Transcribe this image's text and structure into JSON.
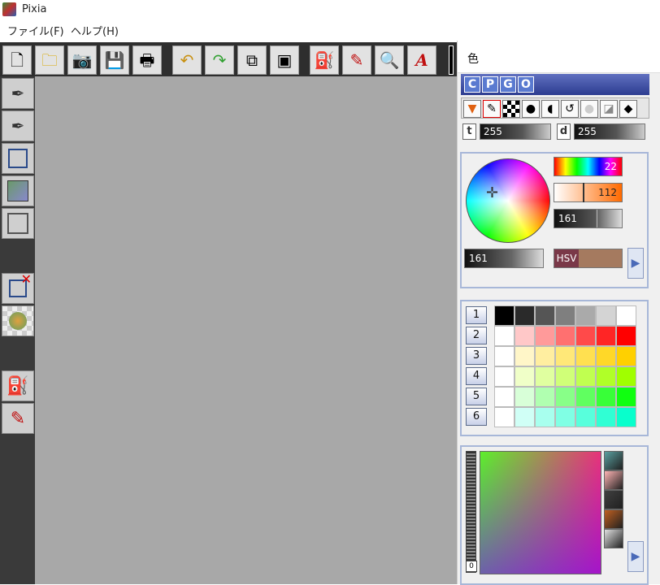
{
  "window": {
    "title": "Pixia"
  },
  "menu": [
    "ファイル(F)",
    "ヘルプ(H)"
  ],
  "toolbar": {
    "icons": [
      "new-file-icon",
      "open-folder-icon",
      "camera-icon",
      "save-disk-icon",
      "printer-icon",
      "undo-icon",
      "redo-icon",
      "copy-icon",
      "save-layer-icon",
      "paint-bucket-icon",
      "paint-pen-icon",
      "magnifier-icon",
      "text-a-icon"
    ]
  },
  "panel": {
    "title": "色",
    "modes": [
      "C",
      "P",
      "G",
      "O"
    ],
    "brush_tools": [
      "fill-triangle-icon",
      "pencil-icon",
      "checker-icon",
      "dot-icon",
      "blob-icon",
      "lasso-icon",
      "circle-icon",
      "squares-icon",
      "eraser-icon"
    ],
    "t": {
      "label": "t",
      "value": "255"
    },
    "d": {
      "label": "d",
      "value": "255"
    },
    "color": {
      "hue": "22",
      "saturation": "112",
      "value": "161",
      "value2": "161",
      "model": "HSV",
      "swatch": "#a57a5f"
    },
    "palette": {
      "rows": [
        "1",
        "2",
        "3",
        "4",
        "5",
        "6"
      ],
      "colors": [
        [
          "#000000",
          "#2a2a2a",
          "#555555",
          "#7f7f7f",
          "#aaaaaa",
          "#d4d4d4",
          "#ffffff"
        ],
        [
          "#ffffff",
          "#ffc8c8",
          "#ff9a9a",
          "#ff7070",
          "#ff4a4a",
          "#ff2525",
          "#ff0000"
        ],
        [
          "#ffffff",
          "#fff6c8",
          "#ffeea0",
          "#ffe878",
          "#ffe050",
          "#ffd828",
          "#ffd000"
        ],
        [
          "#ffffff",
          "#f0ffc8",
          "#e0ffa0",
          "#d0ff78",
          "#c0ff50",
          "#b0ff28",
          "#a0ff00"
        ],
        [
          "#ffffff",
          "#d8ffd8",
          "#b0ffb0",
          "#88ff88",
          "#60ff60",
          "#38ff38",
          "#10ff10"
        ],
        [
          "#ffffff",
          "#d0fff6",
          "#a8ffee",
          "#80ffe4",
          "#58ffdc",
          "#30ffd4",
          "#08ffcc"
        ]
      ]
    },
    "mixer": {
      "scroll_value": "0",
      "swatches": [
        "#5aa0a0",
        "#ffb4b4",
        "#404040",
        "#c06020",
        "#e0e0e0"
      ]
    }
  }
}
